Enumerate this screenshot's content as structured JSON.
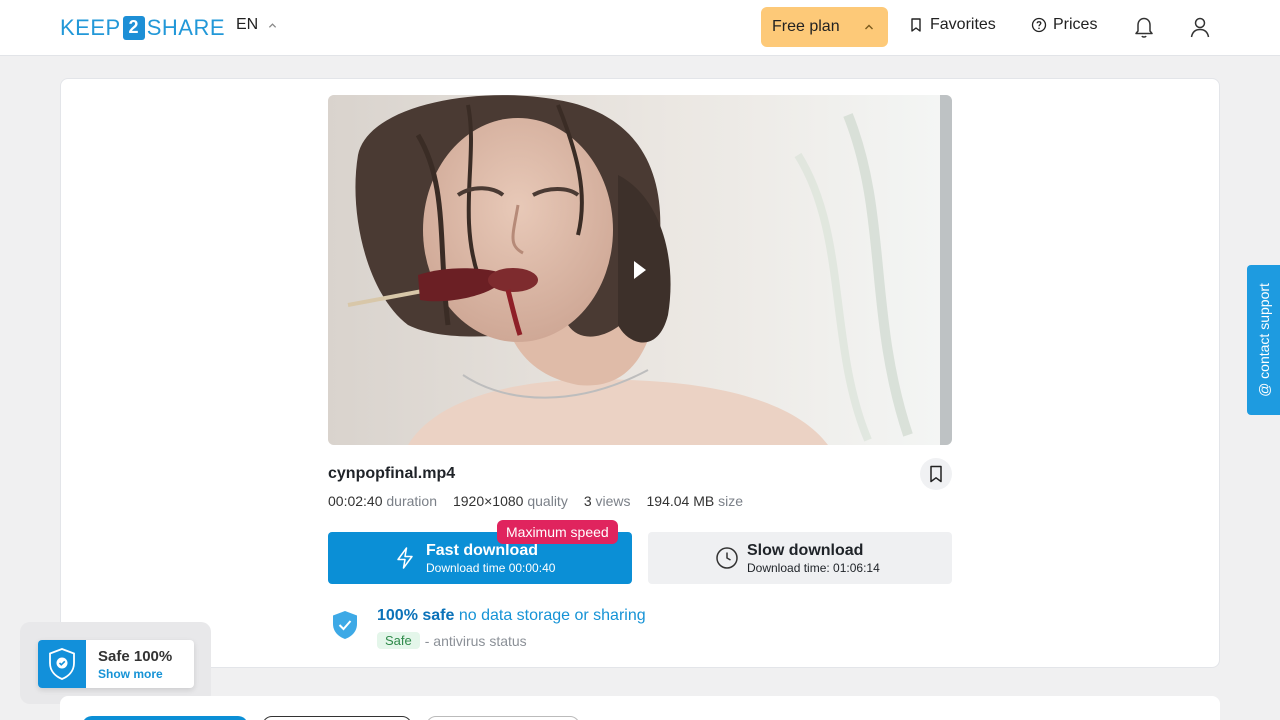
{
  "header": {
    "logo_left": "KEEP",
    "logo_num": "2",
    "logo_right": "SHARE",
    "language": "EN",
    "free_plan": "Free plan",
    "favorites": "Favorites",
    "prices": "Prices"
  },
  "file": {
    "name": "cynpopfinal.mp4",
    "duration_value": "00:02:40",
    "duration_label": "duration",
    "quality_value": "1920×1080",
    "quality_label": "quality",
    "views_value": "3",
    "views_label": "views",
    "size_value": "194.04 MB",
    "size_label": "size"
  },
  "download": {
    "badge": "Maximum speed",
    "fast_title": "Fast download",
    "fast_sub": "Download time 00:00:40",
    "slow_title": "Slow download",
    "slow_sub": "Download time: 01:06:14"
  },
  "safety": {
    "strong": "100% safe",
    "rest": "no data storage or sharing",
    "badge": "Safe",
    "status_text": "- antivirus status"
  },
  "contact_support": "@ contact support",
  "safe_widget": {
    "title": "Safe 100%",
    "link": "Show more"
  },
  "colors": {
    "primary": "#0b8fd6",
    "free_plan_bg": "#fdc978",
    "badge_red": "#e0245e",
    "safe_green": "#2f8a4a"
  }
}
